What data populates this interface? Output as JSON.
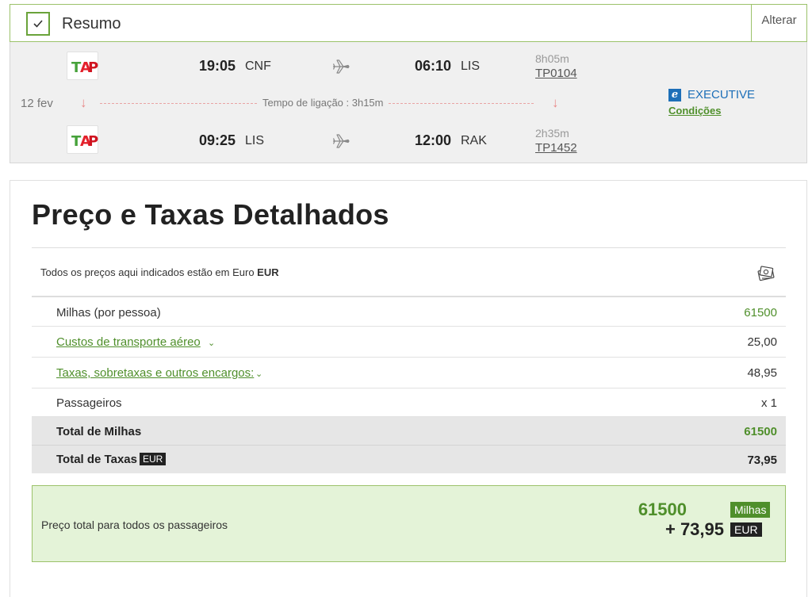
{
  "summary": {
    "title": "Resumo",
    "alter_label": "Alterar"
  },
  "flight": {
    "date": "12 fev",
    "connection_text": "Tempo de ligação : 3h15m",
    "segments": [
      {
        "dep_time": "19:05",
        "dep_code": "CNF",
        "arr_time": "06:10",
        "arr_code": "LIS",
        "duration": "8h05m",
        "flight_number": "TP0104"
      },
      {
        "dep_time": "09:25",
        "dep_code": "LIS",
        "arr_time": "12:00",
        "arr_code": "RAK",
        "duration": "2h35m",
        "flight_number": "TP1452"
      }
    ],
    "cabin": {
      "icon_letter": "e",
      "name": "EXECUTIVE",
      "conditions_label": "Condições"
    },
    "airline_logo": {
      "t": "T",
      "a": "A",
      "p": "P"
    }
  },
  "price": {
    "title": "Preço e Taxas Detalhados",
    "note_prefix": "Todos os preços aqui indicados estão em Euro ",
    "note_currency": "EUR",
    "rows": [
      {
        "label": "Milhas (por pessoa)",
        "value": "61500"
      },
      {
        "label": "Custos de transporte aéreo",
        "value": "25,00"
      },
      {
        "label": "Taxas, sobretaxas e outros encargos:",
        "value": "48,95"
      },
      {
        "label": "Passageiros",
        "value": "x 1"
      }
    ],
    "total_miles": {
      "label": "Total de Milhas",
      "value": "61500"
    },
    "total_taxes": {
      "label": "Total de Taxas",
      "badge": "EUR",
      "value": "73,95"
    },
    "grand": {
      "label": "Preço total para todos os passageiros",
      "miles": "61500",
      "miles_badge": "Milhas",
      "eur": "+ 73,95",
      "eur_badge": "EUR"
    }
  },
  "colors": {
    "accent_green": "#4f8f2b",
    "brand_blue": "#1d6fb8",
    "border_green": "#9bc26a"
  }
}
